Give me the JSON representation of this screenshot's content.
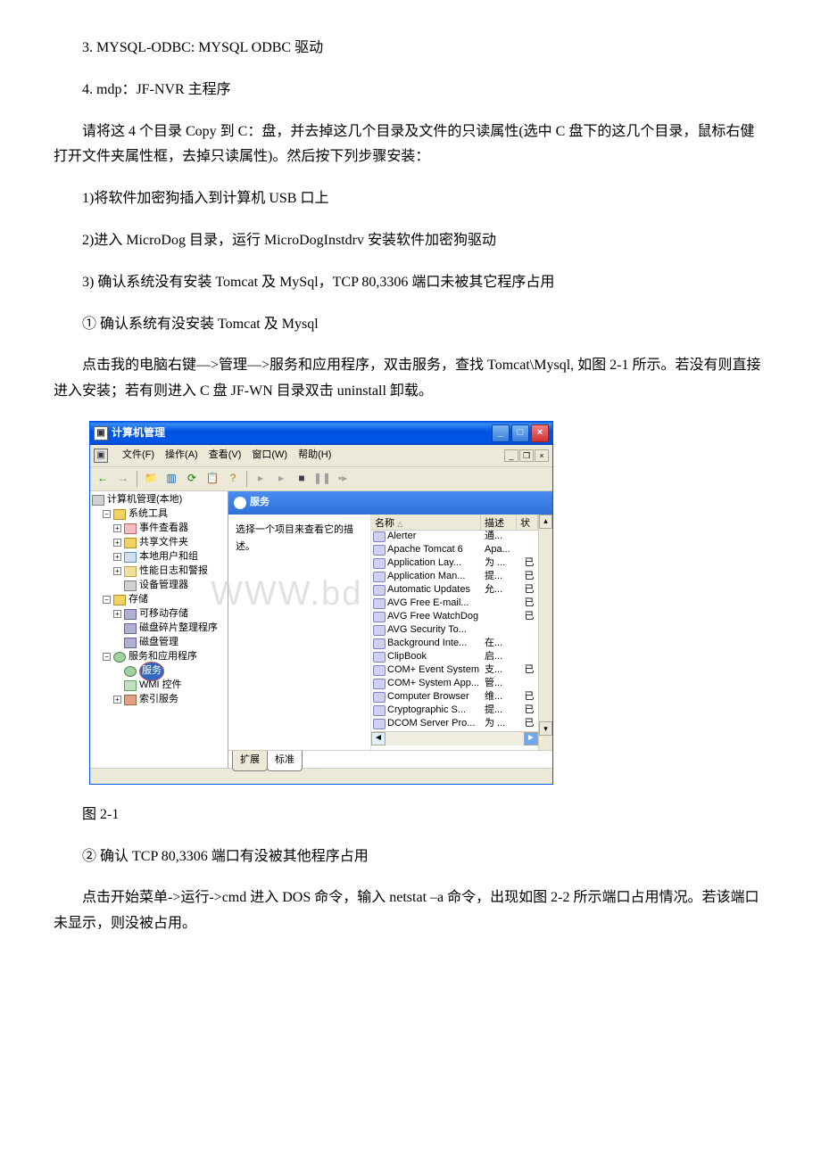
{
  "paragraphs": {
    "p1": "3. MYSQL-ODBC: MYSQL ODBC 驱动",
    "p2": "4. mdp：JF-NVR 主程序",
    "p3": "请将这 4 个目录 Copy 到 C：盘，并去掉这几个目录及文件的只读属性(选中 C 盘下的这几个目录，鼠标右健打开文件夹属性框，去掉只读属性)。然后按下列步骤安装：",
    "p4": "1)将软件加密狗插入到计算机 USB 口上",
    "p5": "2)进入 MicroDog 目录，运行 MicroDogInstdrv 安装软件加密狗驱动",
    "p6": "3) 确认系统没有安装 Tomcat 及 MySql，TCP 80,3306 端口未被其它程序占用",
    "p7": "① 确认系统有没安装 Tomcat 及 Mysql",
    "p8": "点击我的电脑右键—>管理—>服务和应用程序，双击服务，查找 Tomcat\\Mysql, 如图 2-1 所示。若没有则直接进入安装；若有则进入 C 盘 JF-WN 目录双击 uninstall 卸载。",
    "caption1": "图 2-1",
    "p9": "② 确认 TCP 80,3306 端口有没被其他程序占用",
    "p10": "点击开始菜单->运行->cmd 进入 DOS 命令，输入 netstat –a 命令，出现如图 2-2 所示端口占用情况。若该端口未显示，则没被占用。"
  },
  "window": {
    "title": "计算机管理",
    "menus": {
      "file": "文件(F)",
      "action": "操作(A)",
      "view": "查看(V)",
      "window": "窗口(W)",
      "help": "帮助(H)"
    },
    "tree": {
      "root": "计算机管理(本地)",
      "sys_tools": "系统工具",
      "event_viewer": "事件查看器",
      "shared_folders": "共享文件夹",
      "local_users": "本地用户和组",
      "perf_logs": "性能日志和警报",
      "device_mgr": "设备管理器",
      "storage": "存储",
      "removable": "可移动存储",
      "defrag": "磁盘碎片整理程序",
      "disk_mgmt": "磁盘管理",
      "svc_apps": "服务和应用程序",
      "services": "服务",
      "wmi": "WMI 控件",
      "index": "索引服务"
    },
    "panel": {
      "header": "服务",
      "desc_prompt": "选择一个项目来查看它的描述。",
      "col_name": "名称",
      "col_desc": "描述",
      "col_stat": "状",
      "tab_ext": "扩展",
      "tab_std": "标准"
    },
    "services": [
      {
        "name": "Alerter",
        "desc": "通...",
        "stat": ""
      },
      {
        "name": "Apache Tomcat 6",
        "desc": "Apa...",
        "stat": ""
      },
      {
        "name": "Application Lay...",
        "desc": "为 ...",
        "stat": "已"
      },
      {
        "name": "Application Man...",
        "desc": "提...",
        "stat": "已"
      },
      {
        "name": "Automatic Updates",
        "desc": "允...",
        "stat": "已"
      },
      {
        "name": "AVG Free E-mail...",
        "desc": "",
        "stat": "已"
      },
      {
        "name": "AVG Free WatchDog",
        "desc": "",
        "stat": "已"
      },
      {
        "name": "AVG Security To...",
        "desc": "",
        "stat": ""
      },
      {
        "name": "Background Inte...",
        "desc": "在...",
        "stat": ""
      },
      {
        "name": "ClipBook",
        "desc": "启...",
        "stat": ""
      },
      {
        "name": "COM+ Event System",
        "desc": "支...",
        "stat": "已"
      },
      {
        "name": "COM+ System App...",
        "desc": "管...",
        "stat": ""
      },
      {
        "name": "Computer Browser",
        "desc": "维...",
        "stat": "已"
      },
      {
        "name": "Cryptographic S...",
        "desc": "提...",
        "stat": "已"
      },
      {
        "name": "DCOM Server Pro...",
        "desc": "为 ...",
        "stat": "已"
      }
    ],
    "watermark": "WWW.bd"
  }
}
